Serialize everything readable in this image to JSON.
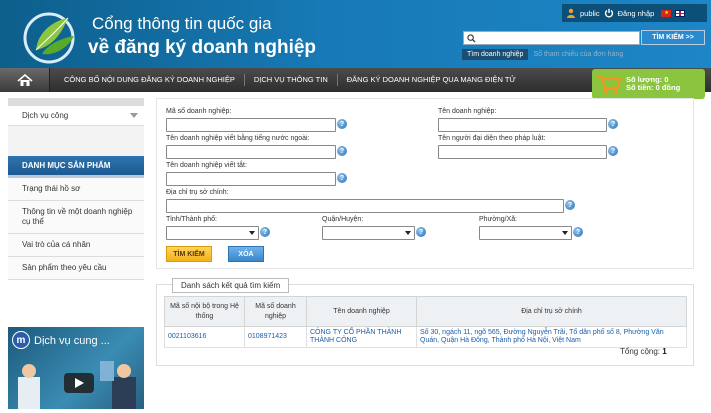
{
  "header": {
    "title_line1": "Cổng thông tin quốc gia",
    "title_line2": "về đăng ký doanh nghiệp",
    "user": "public",
    "login": "Đăng nhập",
    "search_button": "TÌM KIẾM >>",
    "search_placeholder": "",
    "search_tabs": [
      "Tìm doanh nghiệp",
      "Số tham chiếu của đơn hàng"
    ]
  },
  "nav": {
    "items": [
      "CÔNG BỐ NỘI DUNG ĐĂNG KÝ DOANH NGHIỆP",
      "DỊCH VỤ THÔNG TIN",
      "ĐĂNG KÝ DOANH NGHIỆP QUA MẠNG ĐIỆN TỬ"
    ]
  },
  "cart": {
    "quantity": "Số lượng: 0",
    "amount": "Số tiền: 0 đồng"
  },
  "sidebar": {
    "service_select": "Dịch vụ công",
    "category_title": "DANH MỤC SẢN PHẨM",
    "items": [
      "Trạng thái hồ sơ",
      "Thông tin về một doanh nghiệp cụ thể",
      "Vai trò của cá nhân",
      "Sản phẩm theo yêu cầu"
    ],
    "video_title": "Dịch vụ cung ..."
  },
  "form": {
    "labels": {
      "tax_code": "Mã số doanh nghiệp:",
      "name": "Tên doanh nghiệp:",
      "foreign_name": "Tên doanh nghiệp viết bằng tiếng nước ngoài:",
      "legal_rep": "Tên người đại diện theo pháp luật:",
      "short_name": "Tên doanh nghiệp viết tắt:",
      "address": "Địa chỉ trụ sở chính:",
      "province": "Tỉnh/Thành phố:",
      "district": "Quận/Huyện:",
      "ward": "Phường/Xã:"
    },
    "search_button": "TÌM KIẾM",
    "clear_button": "XÓA"
  },
  "results": {
    "legend": "Danh sách kết quả tìm kiếm",
    "headers": [
      "Mã số nội bộ trong Hệ thống",
      "Mã số doanh nghiệp",
      "Tên doanh nghiệp",
      "Địa chỉ trụ sở chính"
    ],
    "rows": [
      [
        "0021103616",
        "0108971423",
        "CÔNG TY CỔ PHẦN THÀNH THÀNH CÔNG",
        "Số 30, ngách 11, ngõ 565, Đường Nguyễn Trãi, Tổ dân phố số 8, Phường Văn Quán, Quận Hà Đông, Thành phố Hà Nội, Việt Nam"
      ]
    ],
    "total_label": "Tổng cộng:",
    "total_value": "1"
  },
  "icons": [
    "logo-leaf-icon",
    "user-icon",
    "power-icon",
    "flag-vn-icon",
    "flag-uk-icon",
    "search-icon",
    "home-icon",
    "cart-icon",
    "help-icon",
    "play-icon"
  ]
}
